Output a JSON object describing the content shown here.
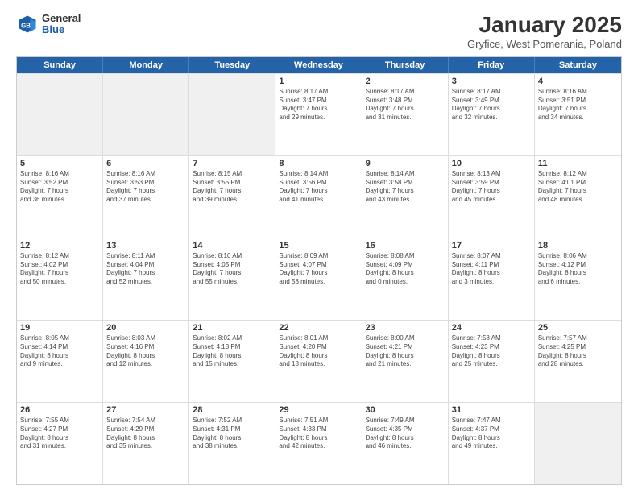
{
  "logo": {
    "general": "General",
    "blue": "Blue"
  },
  "title": {
    "main": "January 2025",
    "sub": "Gryfice, West Pomerania, Poland"
  },
  "header_days": [
    "Sunday",
    "Monday",
    "Tuesday",
    "Wednesday",
    "Thursday",
    "Friday",
    "Saturday"
  ],
  "weeks": [
    [
      {
        "day": "",
        "info": "",
        "shaded": true
      },
      {
        "day": "",
        "info": "",
        "shaded": true
      },
      {
        "day": "",
        "info": "",
        "shaded": true
      },
      {
        "day": "1",
        "info": "Sunrise: 8:17 AM\nSunset: 3:47 PM\nDaylight: 7 hours\nand 29 minutes."
      },
      {
        "day": "2",
        "info": "Sunrise: 8:17 AM\nSunset: 3:48 PM\nDaylight: 7 hours\nand 31 minutes."
      },
      {
        "day": "3",
        "info": "Sunrise: 8:17 AM\nSunset: 3:49 PM\nDaylight: 7 hours\nand 32 minutes."
      },
      {
        "day": "4",
        "info": "Sunrise: 8:16 AM\nSunset: 3:51 PM\nDaylight: 7 hours\nand 34 minutes."
      }
    ],
    [
      {
        "day": "5",
        "info": "Sunrise: 8:16 AM\nSunset: 3:52 PM\nDaylight: 7 hours\nand 36 minutes."
      },
      {
        "day": "6",
        "info": "Sunrise: 8:16 AM\nSunset: 3:53 PM\nDaylight: 7 hours\nand 37 minutes."
      },
      {
        "day": "7",
        "info": "Sunrise: 8:15 AM\nSunset: 3:55 PM\nDaylight: 7 hours\nand 39 minutes."
      },
      {
        "day": "8",
        "info": "Sunrise: 8:14 AM\nSunset: 3:56 PM\nDaylight: 7 hours\nand 41 minutes."
      },
      {
        "day": "9",
        "info": "Sunrise: 8:14 AM\nSunset: 3:58 PM\nDaylight: 7 hours\nand 43 minutes."
      },
      {
        "day": "10",
        "info": "Sunrise: 8:13 AM\nSunset: 3:59 PM\nDaylight: 7 hours\nand 45 minutes."
      },
      {
        "day": "11",
        "info": "Sunrise: 8:12 AM\nSunset: 4:01 PM\nDaylight: 7 hours\nand 48 minutes."
      }
    ],
    [
      {
        "day": "12",
        "info": "Sunrise: 8:12 AM\nSunset: 4:02 PM\nDaylight: 7 hours\nand 50 minutes."
      },
      {
        "day": "13",
        "info": "Sunrise: 8:11 AM\nSunset: 4:04 PM\nDaylight: 7 hours\nand 52 minutes."
      },
      {
        "day": "14",
        "info": "Sunrise: 8:10 AM\nSunset: 4:05 PM\nDaylight: 7 hours\nand 55 minutes."
      },
      {
        "day": "15",
        "info": "Sunrise: 8:09 AM\nSunset: 4:07 PM\nDaylight: 7 hours\nand 58 minutes."
      },
      {
        "day": "16",
        "info": "Sunrise: 8:08 AM\nSunset: 4:09 PM\nDaylight: 8 hours\nand 0 minutes."
      },
      {
        "day": "17",
        "info": "Sunrise: 8:07 AM\nSunset: 4:11 PM\nDaylight: 8 hours\nand 3 minutes."
      },
      {
        "day": "18",
        "info": "Sunrise: 8:06 AM\nSunset: 4:12 PM\nDaylight: 8 hours\nand 6 minutes."
      }
    ],
    [
      {
        "day": "19",
        "info": "Sunrise: 8:05 AM\nSunset: 4:14 PM\nDaylight: 8 hours\nand 9 minutes."
      },
      {
        "day": "20",
        "info": "Sunrise: 8:03 AM\nSunset: 4:16 PM\nDaylight: 8 hours\nand 12 minutes."
      },
      {
        "day": "21",
        "info": "Sunrise: 8:02 AM\nSunset: 4:18 PM\nDaylight: 8 hours\nand 15 minutes."
      },
      {
        "day": "22",
        "info": "Sunrise: 8:01 AM\nSunset: 4:20 PM\nDaylight: 8 hours\nand 18 minutes."
      },
      {
        "day": "23",
        "info": "Sunrise: 8:00 AM\nSunset: 4:21 PM\nDaylight: 8 hours\nand 21 minutes."
      },
      {
        "day": "24",
        "info": "Sunrise: 7:58 AM\nSunset: 4:23 PM\nDaylight: 8 hours\nand 25 minutes."
      },
      {
        "day": "25",
        "info": "Sunrise: 7:57 AM\nSunset: 4:25 PM\nDaylight: 8 hours\nand 28 minutes."
      }
    ],
    [
      {
        "day": "26",
        "info": "Sunrise: 7:55 AM\nSunset: 4:27 PM\nDaylight: 8 hours\nand 31 minutes."
      },
      {
        "day": "27",
        "info": "Sunrise: 7:54 AM\nSunset: 4:29 PM\nDaylight: 8 hours\nand 35 minutes."
      },
      {
        "day": "28",
        "info": "Sunrise: 7:52 AM\nSunset: 4:31 PM\nDaylight: 8 hours\nand 38 minutes."
      },
      {
        "day": "29",
        "info": "Sunrise: 7:51 AM\nSunset: 4:33 PM\nDaylight: 8 hours\nand 42 minutes."
      },
      {
        "day": "30",
        "info": "Sunrise: 7:49 AM\nSunset: 4:35 PM\nDaylight: 8 hours\nand 46 minutes."
      },
      {
        "day": "31",
        "info": "Sunrise: 7:47 AM\nSunset: 4:37 PM\nDaylight: 8 hours\nand 49 minutes."
      },
      {
        "day": "",
        "info": "",
        "shaded": true
      }
    ]
  ]
}
